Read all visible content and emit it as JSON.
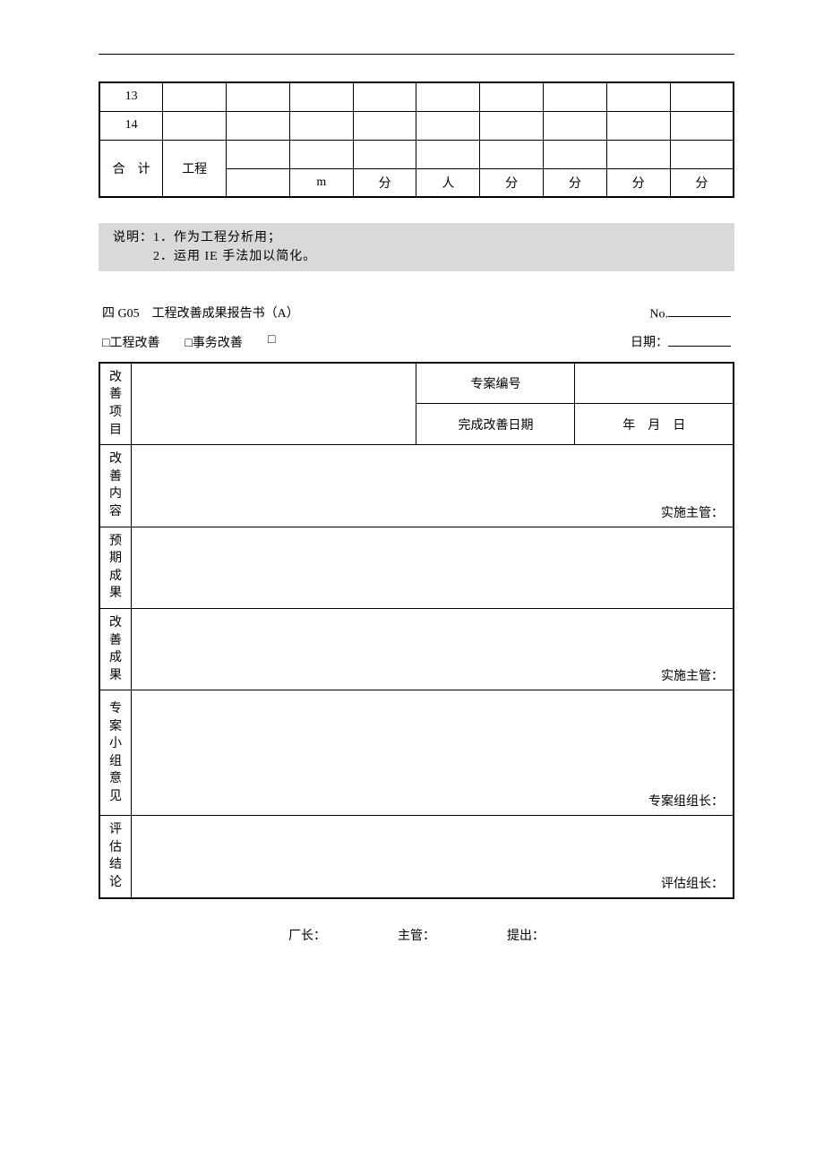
{
  "topTable": {
    "row1": "13",
    "row2": "14",
    "totalLabel": "合　计",
    "projLabel": "工程",
    "units": {
      "u1": "m",
      "u2": "分",
      "u3": "人",
      "u4": "分",
      "u5": "分",
      "u6": "分",
      "u7": "分"
    }
  },
  "note": {
    "prefix": "说明：",
    "line1": "1．作为工程分析用；",
    "line2": "2．运用 IE 手法加以简化。"
  },
  "secTitle": "四 G05　工程改善成果报告书（A）",
  "noLabel": "No.",
  "checks": {
    "c1": "□工程改善",
    "c2": "□事务改善",
    "c3": "□"
  },
  "dateLabel": "日期：",
  "report": {
    "r1": {
      "label": "改善项目",
      "caseNoLabel": "专案编号",
      "finishLabel": "完成改善日期",
      "dateFmt": "年　月　日"
    },
    "r2": {
      "label": "改善内容",
      "signer": "实施主管："
    },
    "r3": {
      "label": "预期成果"
    },
    "r4": {
      "label": "改善成果",
      "signer": "实施主管："
    },
    "r5": {
      "label": "专案小组意见",
      "signer": "专案组组长："
    },
    "r6": {
      "label": "评估结论",
      "signer": "评估组长："
    }
  },
  "footer": {
    "f1": "厂长：",
    "f2": "主管：",
    "f3": "提出："
  }
}
